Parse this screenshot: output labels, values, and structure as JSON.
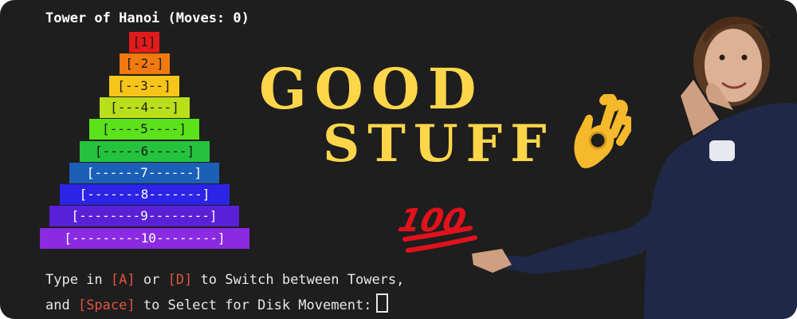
{
  "terminal": {
    "title": "Tower of Hanoi (Moves: 0)",
    "disks": [
      {
        "label": "[1]",
        "color": "#e31b1b",
        "text_color": "#1a1a1a"
      },
      {
        "label": "[-2-]",
        "color": "#f07a10",
        "text_color": "#1a1a1a"
      },
      {
        "label": "[--3--]",
        "color": "#f7c41a",
        "text_color": "#1a1a1a"
      },
      {
        "label": "[---4---]",
        "color": "#b9df1a",
        "text_color": "#1a1a1a"
      },
      {
        "label": "[----5----]",
        "color": "#5be21a",
        "text_color": "#1a1a1a"
      },
      {
        "label": "[-----6-----]",
        "color": "#25c23d",
        "text_color": "#1a1a1a"
      },
      {
        "label": "[------7------]",
        "color": "#1c5fb7",
        "text_color": "#ffffff"
      },
      {
        "label": "[-------8-------]",
        "color": "#2b24e6",
        "text_color": "#ffffff"
      },
      {
        "label": "[--------9--------]",
        "color": "#5a20d8",
        "text_color": "#ffffff"
      },
      {
        "label": "[---------10--------]",
        "color": "#8a2be2",
        "text_color": "#ffffff"
      }
    ],
    "instructions": {
      "line1": {
        "pre": "Type in ",
        "key_a": "[A]",
        "mid": " or ",
        "key_d": "[D]",
        "post": " to Switch between Towers,"
      },
      "line2": {
        "pre": "and ",
        "key_space": "[Space]",
        "post": " to Select for Disk Movement:"
      }
    },
    "key_color": "#e0553f"
  },
  "meme": {
    "word1": "GOOD",
    "word2": "STUFF",
    "text_color": "#ffd64a",
    "ok_hand_icon": "ok-hand-emoji",
    "hundred_icon": "hundred-points-emoji",
    "hundred_text": "100"
  }
}
